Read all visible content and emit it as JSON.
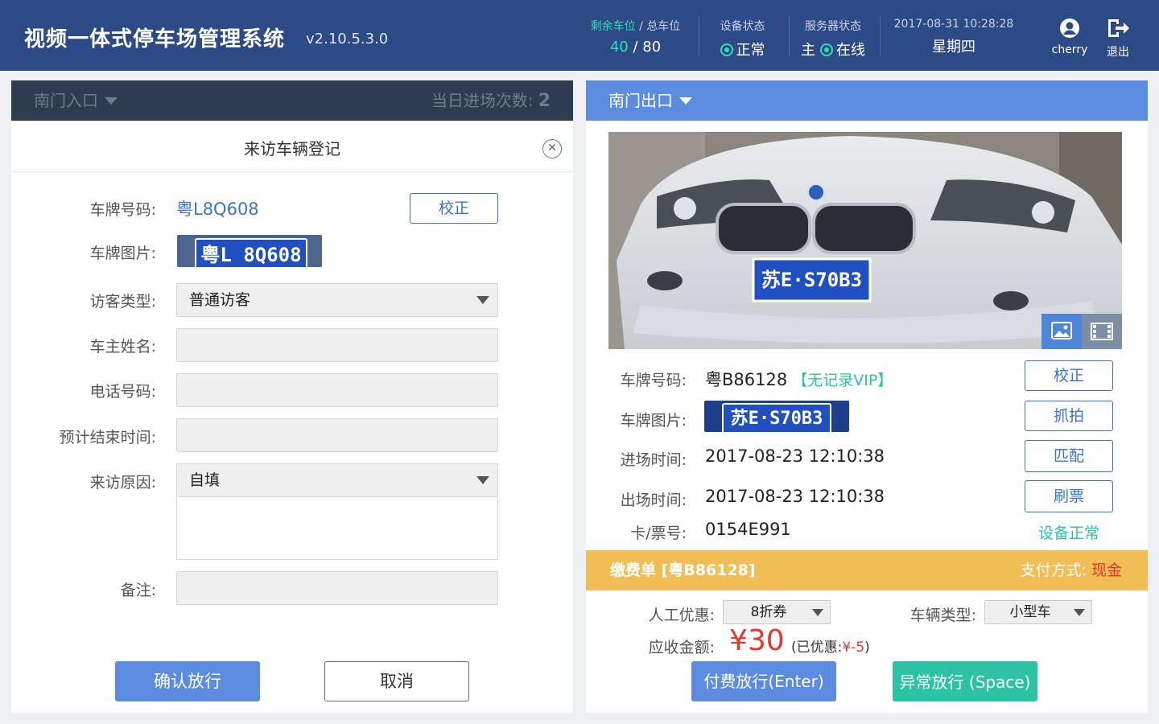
{
  "header": {
    "title": "视频一体式停车场管理系统",
    "version": "v2.10.5.3.0",
    "spaces_label_free": "剩余车位",
    "spaces_label_sep": " / ",
    "spaces_label_total": "总车位",
    "spaces_free": "40",
    "spaces_sep": " / ",
    "spaces_total": "80",
    "device_label": "设备状态",
    "device_status": "正常",
    "server_label": "服务器状态",
    "server_role": "主",
    "server_status": "在线",
    "datetime": "2017-08-31 10:28:28",
    "weekday": "星期四",
    "user_name": "cherry",
    "logout_label": "退出"
  },
  "left_panel": {
    "gate_name": "南门入口",
    "entry_count_label": "当日进场次数:",
    "entry_count": "2"
  },
  "modal": {
    "title": "来访车辆登记",
    "close_icon": "close-icon",
    "plate_label": "车牌号码:",
    "plate_value": "粤L8Q608",
    "correct_btn": "校正",
    "plate_img_label": "车牌图片:",
    "plate_img_text": "粤L 8Q608",
    "visitor_type_label": "访客类型:",
    "visitor_type_value": "普通访客",
    "owner_label": "车主姓名:",
    "owner_value": "",
    "phone_label": "电话号码:",
    "phone_value": "",
    "end_time_label": "预计结束时间:",
    "end_time_value": "",
    "reason_label": "来访原因:",
    "reason_value": "自填",
    "remark_label": "备注:",
    "remark_value": "",
    "confirm_btn": "确认放行",
    "cancel_btn": "取消"
  },
  "right_panel": {
    "gate_name": "南门出口",
    "photo_plate_text": "苏E·S70B3",
    "photo_icons": [
      "image-icon",
      "video-icon"
    ],
    "plate_label": "车牌号码:",
    "plate_value": "粤B86128",
    "plate_tag": "【无记录VIP】",
    "plate_img_label": "车牌图片:",
    "plate_img_text": "苏E·S70B3",
    "entry_label": "进场时间:",
    "entry_time": "2017-08-23 12:10:38",
    "exit_label": "出场时间:",
    "exit_time": "2017-08-23 12:10:38",
    "card_label": "卡/票号:",
    "card_no": "0154E991",
    "btn_correct": "校正",
    "btn_capture": "抓拍",
    "btn_match": "匹配",
    "btn_swipe": "刷票",
    "device_status": "设备正常"
  },
  "payment": {
    "title": "缴费单 [粤B86128]",
    "method_label": "支付方式:",
    "method_value": "现金",
    "discount_label": "人工优惠:",
    "discount_value": "8折券",
    "vehicle_type_label": "车辆类型:",
    "vehicle_type_value": "小型车",
    "amount_label": "应收金额:",
    "amount": "¥30",
    "discounted_prefix": "(已优惠:",
    "discounted_value": "¥-5",
    "discounted_suffix": ")",
    "pay_btn": "付费放行(Enter)",
    "abnormal_btn": "异常放行 (Space)"
  },
  "colors": {
    "header_bg": "#2c4a86",
    "accent_blue": "#5b8ce0",
    "accent_green": "#2fe0b4",
    "teal_btn": "#2bc3a4",
    "pay_bar": "#f1bd55",
    "price_red": "#e8342b"
  }
}
